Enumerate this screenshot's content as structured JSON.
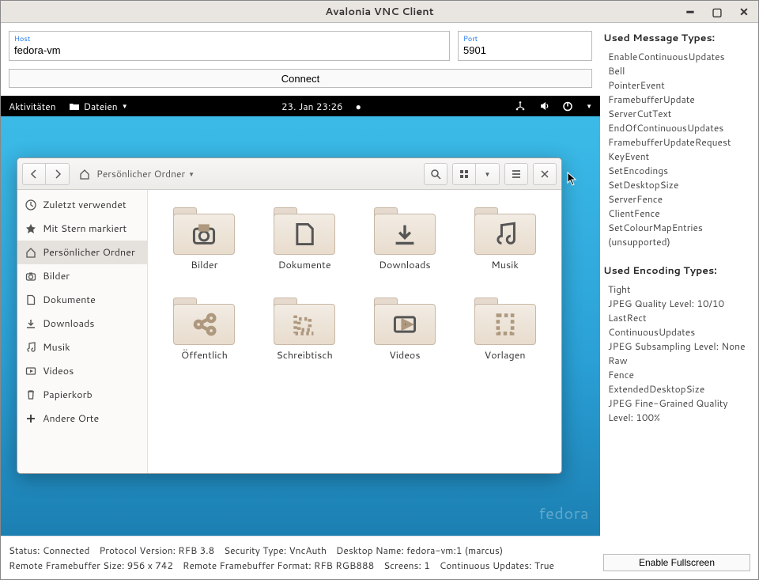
{
  "window": {
    "title": "Avalonia VNC Client"
  },
  "connection": {
    "host_label": "Host",
    "host_value": "fedora-vm",
    "port_label": "Port",
    "port_value": "5901",
    "connect_label": "Connect"
  },
  "message_types": {
    "heading": "Used Message Types:",
    "items": [
      "EnableContinuousUpdates",
      "Bell",
      "PointerEvent",
      "FramebufferUpdate",
      "ServerCutText",
      "EndOfContinuousUpdates",
      "FramebufferUpdateRequest",
      "KeyEvent",
      "SetEncodings",
      "SetDesktopSize",
      "ServerFence",
      "ClientFence",
      "SetColourMapEntries (unsupported)"
    ]
  },
  "encoding_types": {
    "heading": "Used Encoding Types:",
    "items": [
      "Tight",
      "JPEG Quality Level: 10/10",
      "LastRect",
      "ContinuousUpdates",
      "JPEG Subsampling Level: None",
      "Raw",
      "Fence",
      "ExtendedDesktopSize",
      "JPEG Fine-Grained Quality Level: 100%"
    ]
  },
  "fullscreen_label": "Enable Fullscreen",
  "gnome": {
    "activities": "Aktivitäten",
    "app_name": "Dateien",
    "datetime": "23. Jan  23:26",
    "brand": "fedora"
  },
  "files": {
    "path": "Persönlicher Ordner",
    "sidebar": [
      {
        "icon": "clock",
        "label": "Zuletzt verwendet"
      },
      {
        "icon": "star",
        "label": "Mit Stern markiert"
      },
      {
        "icon": "home",
        "label": "Persönlicher Ordner",
        "selected": true
      },
      {
        "icon": "camera",
        "label": "Bilder"
      },
      {
        "icon": "doc",
        "label": "Dokumente"
      },
      {
        "icon": "download",
        "label": "Downloads"
      },
      {
        "icon": "music",
        "label": "Musik"
      },
      {
        "icon": "video",
        "label": "Videos"
      },
      {
        "icon": "trash",
        "label": "Papierkorb"
      },
      {
        "icon": "plus",
        "label": "Andere Orte"
      }
    ],
    "folders": [
      {
        "icon": "camera",
        "label": "Bilder"
      },
      {
        "icon": "doc",
        "label": "Dokumente"
      },
      {
        "icon": "download",
        "label": "Downloads"
      },
      {
        "icon": "music",
        "label": "Musik"
      },
      {
        "icon": "share",
        "label": "Öffentlich"
      },
      {
        "icon": "desktop",
        "label": "Schreibtisch"
      },
      {
        "icon": "video",
        "label": "Videos"
      },
      {
        "icon": "template",
        "label": "Vorlagen"
      }
    ]
  },
  "status": {
    "line1": [
      {
        "k": "Status:",
        "v": "Connected"
      },
      {
        "k": "Protocol Version:",
        "v": "RFB 3.8"
      },
      {
        "k": "Security Type:",
        "v": "VncAuth"
      },
      {
        "k": "Desktop Name:",
        "v": "fedora-vm:1 (marcus)"
      }
    ],
    "line2": [
      {
        "k": "Remote Framebuffer Size:",
        "v": "956 x 742"
      },
      {
        "k": "Remote Framebuffer Format:",
        "v": "RFB RGB888"
      },
      {
        "k": "Screens:",
        "v": "1"
      },
      {
        "k": "Continuous Updates:",
        "v": "True"
      }
    ]
  }
}
